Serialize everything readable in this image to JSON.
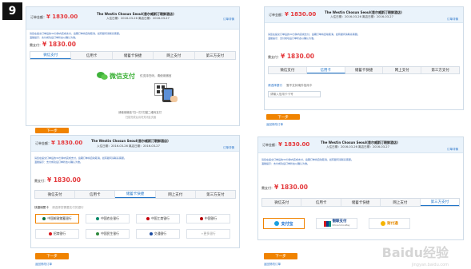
{
  "step": "9",
  "order": {
    "label": "订单金额：",
    "amount": "¥ 1830.00",
    "title": "The Westin Chosun Seoul(首尔威斯汀朝鲜酒店)",
    "dates": "入住日期：2016-03-26 离店日期：2016-03-27",
    "more": "订单详情",
    "notice1": "请您在提交订单后的30分钟内完成支付，逾期订单将自动取消，如有疑问请联系客服。",
    "notice2": "温馨提示：支付成功后订单状态以确认为准。"
  },
  "pay": {
    "label": "需支付：",
    "amount": "¥ 1830.00"
  },
  "tabs": [
    "微信支付",
    "信用卡",
    "储蓄卡快捷",
    "网上支付",
    "第三方支付"
  ],
  "wechat": {
    "logo_text": "微信支付",
    "tip": "仅支持扫码，请使用微信",
    "guide": "请使用微信\"扫一扫\"扫描二维码支付",
    "hint": "扫描完成后请勿关闭此页面"
  },
  "credit": {
    "type_label": "请选择银行",
    "type_hint": "暂不支持境外信用卡",
    "input_placeholder": "请输入信用卡卡号"
  },
  "debit": {
    "label": "快捷储蓄卡",
    "hint": "请选择您需要支付的银行",
    "banks": [
      "中国邮政储蓄银行",
      "中国农业银行",
      "中国工商银行",
      "中国银行",
      "招商银行",
      "中国民生银行",
      "交通银行",
      "+更多银行"
    ]
  },
  "third": {
    "options": [
      "支付宝",
      "银联支付",
      "财付通"
    ],
    "unionpay_sub": "China UnionPay"
  },
  "buttons": {
    "next": "下一步"
  },
  "links": {
    "back": "返回修改订单"
  },
  "watermark": {
    "main": "Baidu经验",
    "sub": "jingyan.baidu.com"
  },
  "colors": {
    "accent": "#f08300",
    "price": "#e4393c",
    "link": "#2a74c9",
    "header_bg": "#eaf3fb"
  }
}
